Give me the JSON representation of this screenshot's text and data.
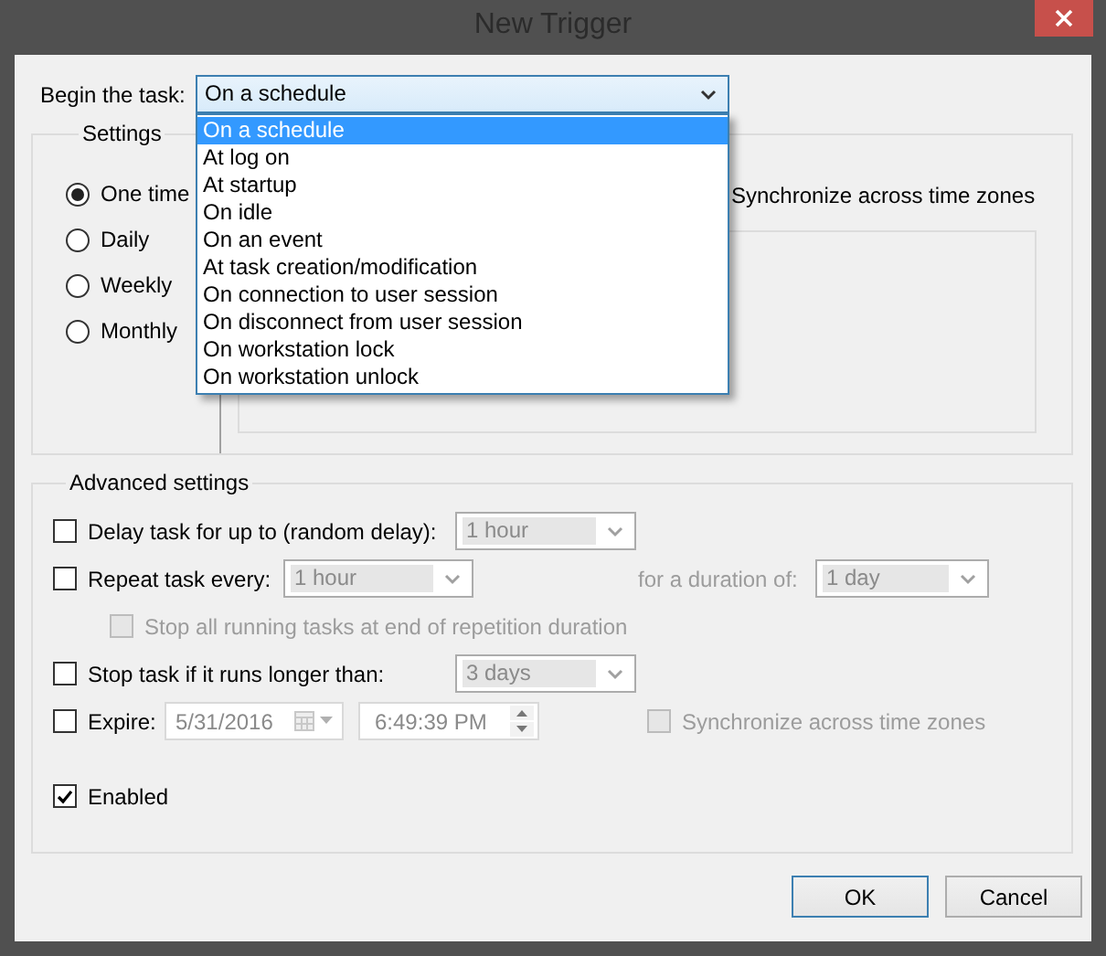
{
  "window": {
    "title": "New Trigger"
  },
  "begin_task": {
    "label": "Begin the task:",
    "value": "On a schedule",
    "expanded": true,
    "options": [
      {
        "label": "On a schedule",
        "selected": true
      },
      {
        "label": "At log on",
        "selected": false
      },
      {
        "label": "At startup",
        "selected": false
      },
      {
        "label": "On idle",
        "selected": false
      },
      {
        "label": "On an event",
        "selected": false
      },
      {
        "label": "At task creation/modification",
        "selected": false
      },
      {
        "label": "On connection to user session",
        "selected": false
      },
      {
        "label": "On disconnect from user session",
        "selected": false
      },
      {
        "label": "On workstation lock",
        "selected": false
      },
      {
        "label": "On workstation unlock",
        "selected": false
      }
    ]
  },
  "settings": {
    "title": "Settings",
    "schedules": [
      {
        "label": "One time",
        "selected": true
      },
      {
        "label": "Daily",
        "selected": false
      },
      {
        "label": "Weekly",
        "selected": false
      },
      {
        "label": "Monthly",
        "selected": false
      }
    ],
    "sync_time_zones": {
      "label": "Synchronize across time zones"
    }
  },
  "advanced": {
    "title": "Advanced settings",
    "delay": {
      "label": "Delay task for up to (random delay):",
      "checked": false,
      "value": "1 hour",
      "disabled": true
    },
    "repeat": {
      "label": "Repeat task every:",
      "checked": false,
      "value": "1 hour",
      "disabled": true,
      "duration_label": "for a duration of:",
      "duration_value": "1 day"
    },
    "stop_at_end": {
      "label": "Stop all running tasks at end of repetition duration",
      "checked": false,
      "disabled": true
    },
    "stop_if_longer": {
      "label": "Stop task if it runs longer than:",
      "checked": false,
      "value": "3 days",
      "disabled": true
    },
    "expire": {
      "label": "Expire:",
      "checked": false,
      "date": "5/31/2016",
      "time": "6:49:39 PM",
      "disabled": true,
      "sync_label": "Synchronize across time zones",
      "sync_checked": false
    },
    "enabled": {
      "label": "Enabled",
      "checked": true
    }
  },
  "buttons": [
    {
      "label": "OK",
      "default": true
    },
    {
      "label": "Cancel",
      "default": false
    }
  ]
}
